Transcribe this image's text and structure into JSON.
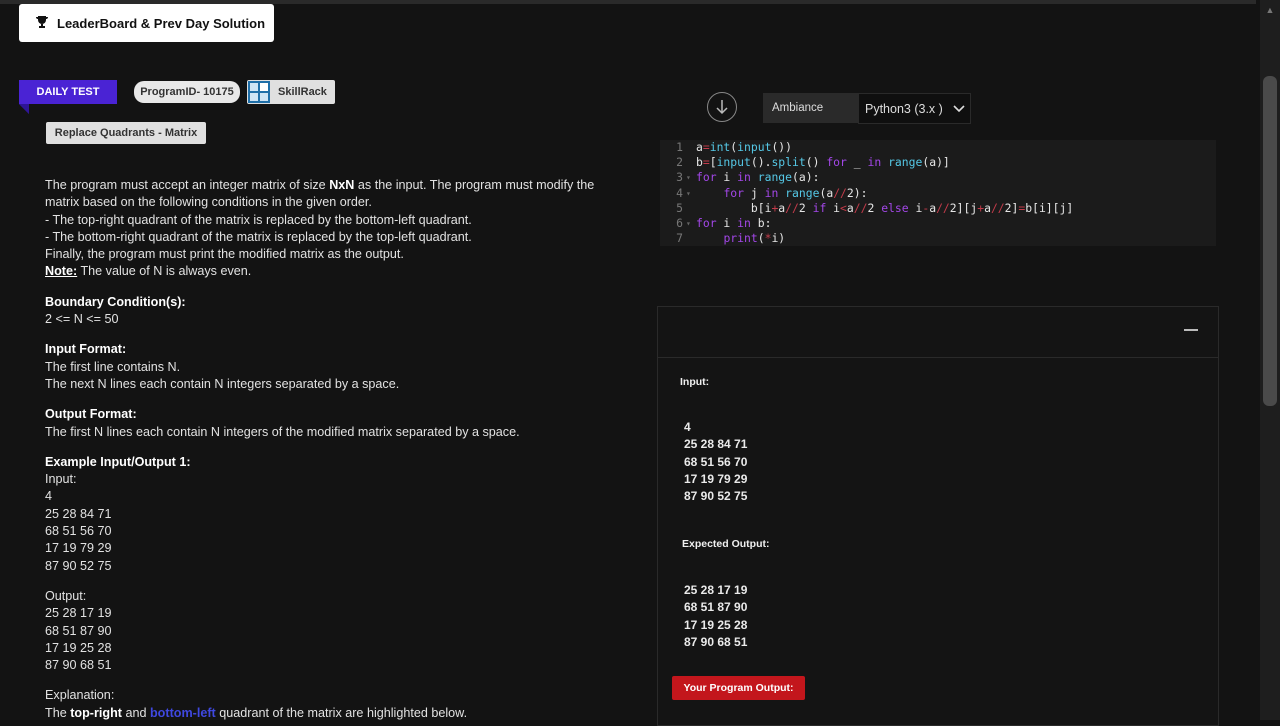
{
  "header": {
    "leaderboard_label": "LeaderBoard & Prev Day Solution",
    "daily_test": "DAILY TEST",
    "program_id": "ProgramID- 10175",
    "skillrack": "SkillRack",
    "title": "Replace Quadrants - Matrix"
  },
  "problem": {
    "intro_1": "The program must accept an integer matrix of size ",
    "intro_bold": "NxN",
    "intro_2": " as the input. The program must modify the matrix based on the following conditions in the given order.",
    "cond_1": "- The top-right quadrant of the matrix is replaced by the bottom-left quadrant.",
    "cond_2": "- The bottom-right quadrant of the matrix is replaced by the top-left quadrant.",
    "finally": "Finally, the program must print the modified matrix as the output.",
    "note_label": "Note:",
    "note_text": " The value of N is always even.",
    "boundary_heading": "Boundary Condition(s):",
    "boundary_text": "2 <= N <= 50",
    "input_heading": "Input Format:",
    "input_1": "The first line contains N.",
    "input_2": "The next N lines each contain N integers separated by a space.",
    "output_heading": "Output Format:",
    "output_1": "The first N lines each contain N integers of the modified matrix separated by a space.",
    "example_heading": "Example Input/Output 1:",
    "ex_input_label": "Input:",
    "ex_input": [
      "4",
      "25 28 84 71",
      "68 51 56 70",
      "17 19 79 29",
      "87 90 52 75"
    ],
    "ex_output_label": "Output:",
    "ex_output": [
      "25 28 17 19",
      "68 51 87 90",
      "17 19 25 28",
      "87 90 68 51"
    ],
    "explanation_label": "Explanation:",
    "expl_1": "The ",
    "expl_bold": "top-right",
    "expl_2": " and ",
    "expl_blue": "bottom-left",
    "expl_3": " quadrant of the matrix are highlighted below."
  },
  "editor": {
    "ambiance": "Ambiance",
    "language": "Python3 (3.x )",
    "line_numbers": [
      "1",
      "2",
      "3",
      "4",
      "5",
      "6",
      "7"
    ]
  },
  "io_panel": {
    "input_label": "Input:",
    "input_values": [
      "4",
      "25 28 84 71",
      "68 51 56 70",
      "17 19 79 29",
      "87 90 52 75"
    ],
    "expected_label": "Expected Output:",
    "expected_values": [
      "25 28 17 19",
      "68 51 87 90",
      "17 19 25 28",
      "87 90 68 51"
    ],
    "run_label": "Your Program Output:"
  },
  "colors": {
    "ribbon": "#4a23d4",
    "run_button": "#c3161c",
    "keyword": "#a347e8",
    "function": "#55c8e6"
  }
}
